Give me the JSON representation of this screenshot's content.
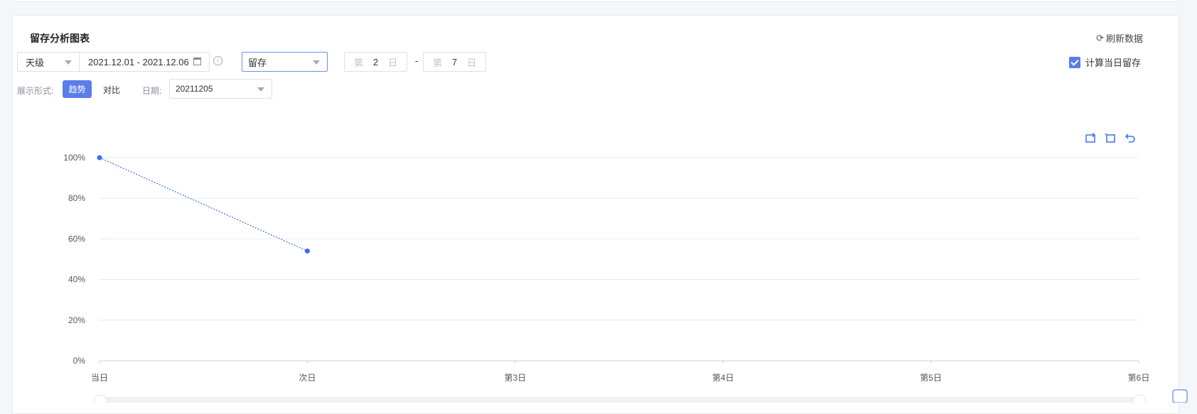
{
  "panel": {
    "title": "留存分析图表",
    "refresh_label": "刷新数据"
  },
  "filters": {
    "granularity": "天级",
    "date_range": "2021.12.01 - 2021.12.06",
    "metric": "留存",
    "day_prefix": "第",
    "day_suffix": "日",
    "day_from": "2",
    "day_to": "7",
    "range_separator": "-",
    "include_same_day_label": "计算当日留存",
    "include_same_day_checked": true
  },
  "display": {
    "mode_label": "展示形式:",
    "mode_trend": "趋势",
    "mode_compare": "对比",
    "date_label": "日期:",
    "date_value": "20211205"
  },
  "colors": {
    "accent": "#5b7de8",
    "line": "#3b6ff0"
  },
  "toolbox": {
    "icons": [
      "zoom-icon",
      "zoom-reset-icon",
      "restore-icon"
    ]
  },
  "chart_data": {
    "type": "line",
    "categories": [
      "当日",
      "次日",
      "第3日",
      "第4日",
      "第5日",
      "第6日"
    ],
    "series": [
      {
        "values": [
          100,
          54,
          null,
          null,
          null,
          null
        ]
      }
    ],
    "ylim": [
      0,
      100
    ],
    "yticks": [
      "0%",
      "20%",
      "40%",
      "60%",
      "80%",
      "100%"
    ],
    "grid": true
  }
}
